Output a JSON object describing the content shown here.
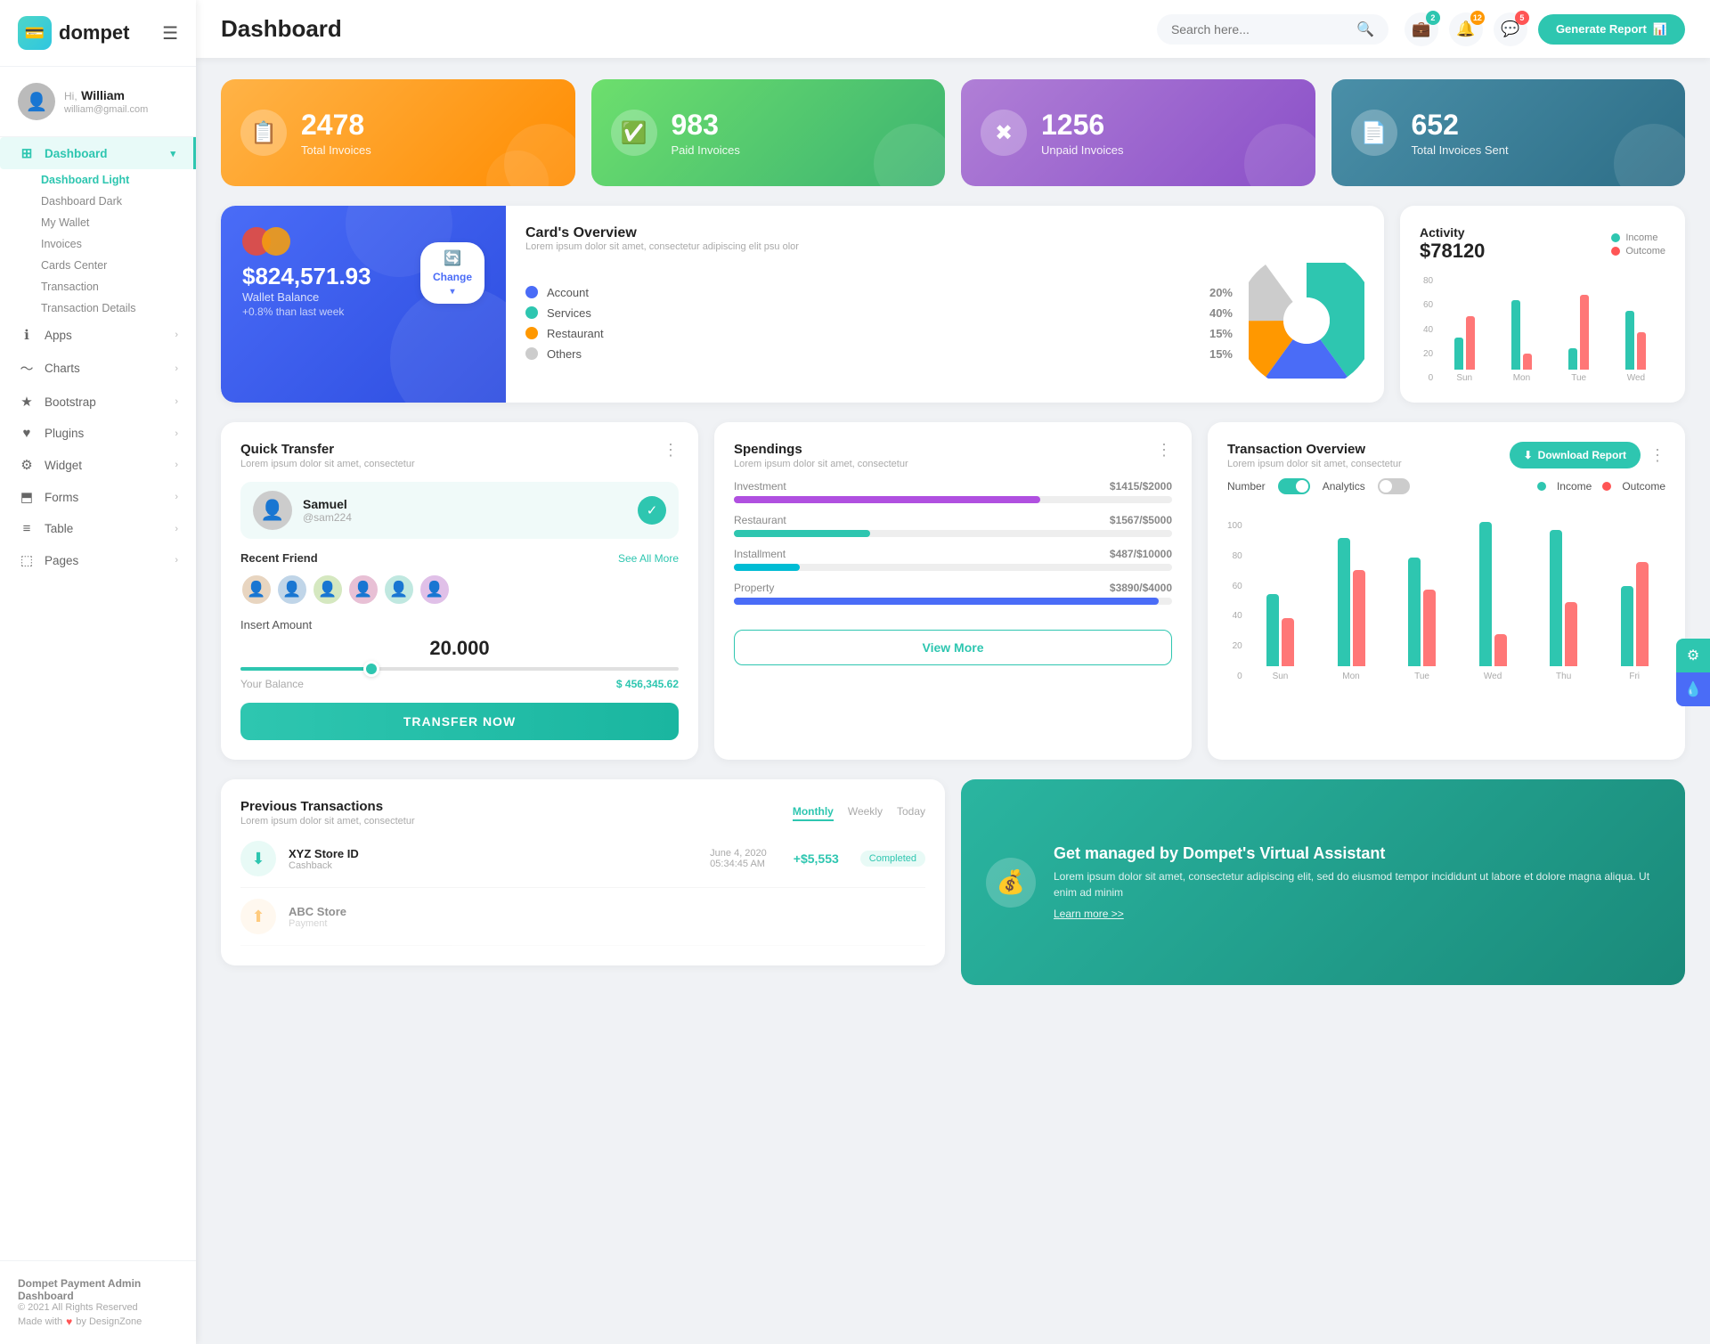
{
  "app": {
    "logo": "💳",
    "name": "dompet"
  },
  "topbar": {
    "title": "Dashboard",
    "search_placeholder": "Search here...",
    "generate_btn": "Generate Report",
    "icons": {
      "wallet_badge": "2",
      "bell_badge": "12",
      "chat_badge": "5"
    }
  },
  "user": {
    "hi": "Hi,",
    "name": "William",
    "email": "william@gmail.com"
  },
  "sidebar": {
    "nav_items": [
      {
        "label": "Dashboard",
        "icon": "⊞",
        "active": true,
        "has_sub": true
      },
      {
        "label": "Apps",
        "icon": "ℹ",
        "active": false,
        "has_sub": false
      },
      {
        "label": "Charts",
        "icon": "〜",
        "active": false,
        "has_sub": false
      },
      {
        "label": "Bootstrap",
        "icon": "★",
        "active": false,
        "has_sub": false
      },
      {
        "label": "Plugins",
        "icon": "♥",
        "active": false,
        "has_sub": false
      },
      {
        "label": "Widget",
        "icon": "⚙",
        "active": false,
        "has_sub": false
      },
      {
        "label": "Forms",
        "icon": "⬒",
        "active": false,
        "has_sub": false
      },
      {
        "label": "Table",
        "icon": "≡",
        "active": false,
        "has_sub": false
      },
      {
        "label": "Pages",
        "icon": "⬚",
        "active": false,
        "has_sub": false
      }
    ],
    "sub_items": [
      {
        "label": "Dashboard Light",
        "active": true
      },
      {
        "label": "Dashboard Dark",
        "active": false
      },
      {
        "label": "My Wallet",
        "active": false
      },
      {
        "label": "Invoices",
        "active": false
      },
      {
        "label": "Cards Center",
        "active": false
      },
      {
        "label": "Transaction",
        "active": false
      },
      {
        "label": "Transaction Details",
        "active": false
      }
    ],
    "footer": {
      "company": "Dompet Payment Admin Dashboard",
      "year": "© 2021 All Rights Reserved",
      "made_with": "Made with",
      "by": "by DesignZone"
    }
  },
  "stat_cards": [
    {
      "number": "2478",
      "label": "Total Invoices",
      "color": "orange",
      "icon": "📋"
    },
    {
      "number": "983",
      "label": "Paid Invoices",
      "color": "green",
      "icon": "✅"
    },
    {
      "number": "1256",
      "label": "Unpaid Invoices",
      "color": "purple",
      "icon": "✖"
    },
    {
      "number": "652",
      "label": "Total Invoices Sent",
      "color": "teal",
      "icon": "📄"
    }
  ],
  "wallet": {
    "amount": "$824,571.93",
    "label": "Wallet Balance",
    "change": "+0.8% than last week",
    "change_btn": "Change"
  },
  "cards_overview": {
    "title": "Card's Overview",
    "desc": "Lorem ipsum dolor sit amet, consectetur adipiscing elit psu olor",
    "items": [
      {
        "name": "Account",
        "pct": "20%",
        "color": "#4a6cf7"
      },
      {
        "name": "Services",
        "pct": "40%",
        "color": "#2ec6b0"
      },
      {
        "name": "Restaurant",
        "pct": "15%",
        "color": "#ff9800"
      },
      {
        "name": "Others",
        "pct": "15%",
        "color": "#cccccc"
      }
    ]
  },
  "activity": {
    "title": "Activity",
    "amount": "$78120",
    "legend": [
      {
        "label": "Income",
        "color": "#2ec6b0"
      },
      {
        "label": "Outcome",
        "color": "#f55"
      }
    ],
    "bars": {
      "labels": [
        "Sun",
        "Mon",
        "Tue",
        "Wed"
      ],
      "income": [
        30,
        65,
        20,
        55
      ],
      "outcome": [
        50,
        15,
        70,
        35
      ]
    }
  },
  "quick_transfer": {
    "title": "Quick Transfer",
    "desc": "Lorem ipsum dolor sit amet, consectetur",
    "selected_user": {
      "name": "Samuel",
      "handle": "@sam224"
    },
    "recent_label": "Recent Friend",
    "see_all": "See All More",
    "insert_label": "Insert Amount",
    "amount": "20.000",
    "balance_label": "Your Balance",
    "balance_val": "$ 456,345.62",
    "transfer_btn": "TRANSFER NOW"
  },
  "spendings": {
    "title": "Spendings",
    "desc": "Lorem ipsum dolor sit amet, consectetur",
    "items": [
      {
        "label": "Investment",
        "current": "$1415",
        "total": "$2000",
        "pct": 70,
        "color": "#b050e0"
      },
      {
        "label": "Restaurant",
        "current": "$1567",
        "total": "$5000",
        "pct": 31,
        "color": "#2ec6b0"
      },
      {
        "label": "Installment",
        "current": "$487",
        "total": "$10000",
        "pct": 15,
        "color": "#00bcd4"
      },
      {
        "label": "Property",
        "current": "$3890",
        "total": "$4000",
        "pct": 97,
        "color": "#4a6cf7"
      }
    ],
    "view_more": "View More"
  },
  "transaction_overview": {
    "title": "Transaction Overview",
    "desc": "Lorem ipsum dolor sit amet, consectetur",
    "download_btn": "Download Report",
    "toggle_number": "Number",
    "toggle_analytics": "Analytics",
    "legend": [
      {
        "label": "Income",
        "color": "#2ec6b0"
      },
      {
        "label": "Outcome",
        "color": "#f55"
      }
    ],
    "bars": {
      "labels": [
        "Sun",
        "Mon",
        "Tue",
        "Wed",
        "Thu",
        "Fri"
      ],
      "income": [
        45,
        80,
        68,
        90,
        85,
        50
      ],
      "outcome": [
        30,
        60,
        48,
        20,
        40,
        65
      ]
    },
    "y_labels": [
      "0",
      "20",
      "40",
      "60",
      "80",
      "100"
    ]
  },
  "prev_transactions": {
    "title": "Previous Transactions",
    "desc": "Lorem ipsum dolor sit amet, consectetur",
    "tabs": [
      "Monthly",
      "Weekly",
      "Today"
    ],
    "active_tab": "Monthly",
    "items": [
      {
        "icon": "⬇",
        "icon_bg": "#e8faf6",
        "icon_color": "#2ec6b0",
        "name": "XYZ Store ID",
        "type": "Cashback",
        "date": "June 4, 2020",
        "time": "05:34:45 AM",
        "amount": "+$5,553",
        "status": "Completed"
      }
    ]
  },
  "va_banner": {
    "title": "Get managed by Dompet's Virtual Assistant",
    "desc": "Lorem ipsum dolor sit amet, consectetur adipiscing elit, sed do eiusmod tempor incididunt ut labore et dolore magna aliqua. Ut enim ad minim",
    "learn_more": "Learn more >>"
  }
}
